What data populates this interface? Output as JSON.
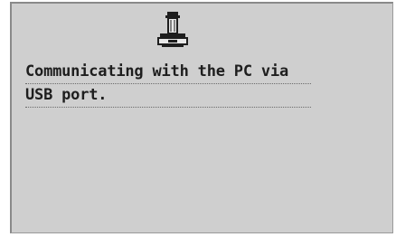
{
  "screen": {
    "icon": "usb-printer-communication-icon",
    "message_lines": [
      "Communicating with the PC via",
      "USB port."
    ],
    "colors": {
      "background": "#cfcfcf",
      "text": "#1e1e1e",
      "border": "#8a8a8a"
    }
  }
}
